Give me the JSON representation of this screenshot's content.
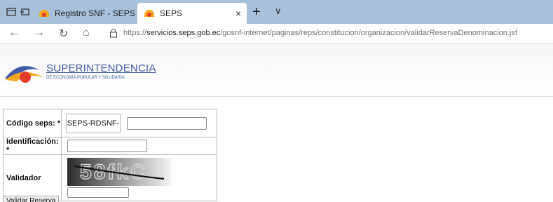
{
  "browser": {
    "tabs": [
      {
        "label": "Registro SNF - SEPS"
      },
      {
        "label": "SEPS"
      }
    ],
    "address": {
      "scheme": "https://",
      "host": "servicios.seps.gob.ec",
      "path": "/gosnf-internet/paginas/reps/constitucion/organizacion/validarReservaDenominacion.jsf"
    },
    "new_tab_glyph": "+",
    "tab_list_glyph": "∨",
    "close_glyph": "×",
    "back_glyph": "←",
    "forward_glyph": "→",
    "refresh_glyph": "↻",
    "home_glyph": "⌂"
  },
  "header": {
    "title": "SUPERINTENDENCIA",
    "subtitle": "DE ECONOMÍA POPULAR Y SOLIDARIA"
  },
  "form": {
    "codigo_label": "Código seps: *",
    "codigo_prefix": "SEPS-RDSNF-",
    "codigo_value": "",
    "identificacion_label": "Identificación: *",
    "identificacion_value": "",
    "validador_label": "Validador",
    "validador_value": "",
    "captcha_text": "58fkC",
    "submit_label": "Validar Reserva"
  },
  "colors": {
    "tabstrip": "#a9c0d9",
    "brand_blue": "#3f5aa8",
    "logo_orange": "#f2a81d",
    "logo_red": "#e23b2a"
  }
}
